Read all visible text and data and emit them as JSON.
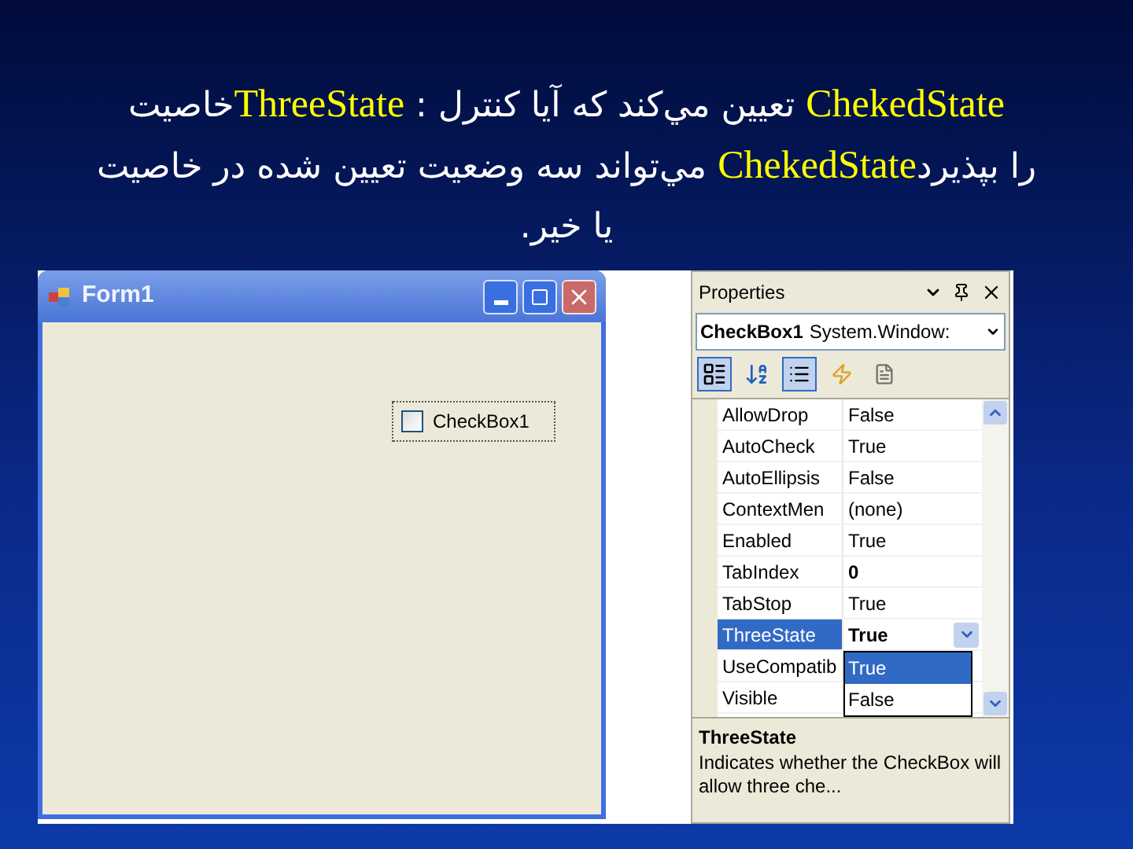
{
  "heading": {
    "lines": [
      "خاصيت**ThreeState** : تعيين مي‌كند كه آيا كنترل  **ChekedState**",
      "مي‌تواند سه وضعيت تعيين شده در خاصيت **ChekedState**را بپذيرد",
      ".يا خير"
    ]
  },
  "form_window": {
    "title": "Form1",
    "checkbox": {
      "label": "CheckBox1",
      "checked": false
    }
  },
  "properties": {
    "title": "Properties",
    "object_name": "CheckBox1",
    "object_type": "System.Window:",
    "rows": [
      {
        "name": "AllowDrop",
        "value": "False",
        "modified": false,
        "selected": false
      },
      {
        "name": "AutoCheck",
        "value": "True",
        "modified": false,
        "selected": false
      },
      {
        "name": "AutoEllipsis",
        "value": "False",
        "modified": false,
        "selected": false
      },
      {
        "name": "ContextMen",
        "value": "(none)",
        "modified": false,
        "selected": false
      },
      {
        "name": "Enabled",
        "value": "True",
        "modified": false,
        "selected": false
      },
      {
        "name": "TabIndex",
        "value": "0",
        "modified": true,
        "selected": false
      },
      {
        "name": "TabStop",
        "value": "True",
        "modified": false,
        "selected": false
      },
      {
        "name": "ThreeState",
        "value": "True",
        "modified": true,
        "selected": true
      },
      {
        "name": "UseCompatib",
        "selected": false
      },
      {
        "name": "Visible",
        "selected": false
      }
    ],
    "dropdown": {
      "options": [
        {
          "label": "True",
          "selected": true
        },
        {
          "label": "False",
          "selected": false
        }
      ]
    },
    "description": {
      "title": "ThreeState",
      "text": "Indicates whether the CheckBox will allow three che..."
    }
  }
}
